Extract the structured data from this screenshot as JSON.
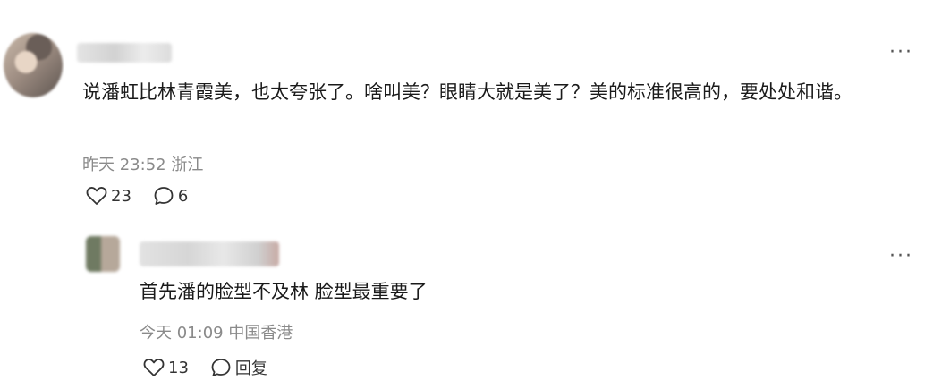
{
  "comment": {
    "more_label": "···",
    "text": "说潘虹比林青霞美，也太夸张了。啥叫美？眼睛大就是美了？美的标准很高的，要处处和谐。",
    "time": "昨天 23:52",
    "location": "浙江",
    "likes": "23",
    "replies": "6"
  },
  "reply": {
    "more_label": "···",
    "text": "首先潘的脸型不及林 脸型最重要了",
    "time": "今天 01:09",
    "location": "中国香港",
    "likes": "13",
    "reply_label": "回复"
  }
}
